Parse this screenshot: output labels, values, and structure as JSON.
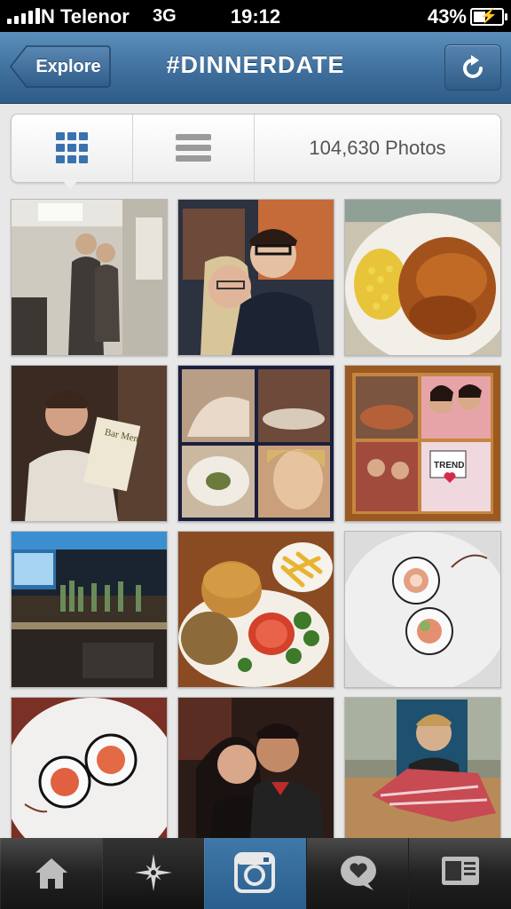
{
  "status_bar": {
    "carrier": "N Telenor",
    "network": "3G",
    "time": "19:12",
    "battery_text": "43%",
    "battery_level": 0.43,
    "signal_bars": 5
  },
  "nav": {
    "back_label": "Explore",
    "title": "#DINNERDATE",
    "refresh_icon": "refresh-icon"
  },
  "view_toggle": {
    "grid_icon": "grid-view-icon",
    "list_icon": "list-view-icon",
    "selected": "grid",
    "photo_count": "104,630 Photos"
  },
  "photos": [
    {
      "desc": "two young men standing in a room"
    },
    {
      "desc": "couple selfie"
    },
    {
      "desc": "chicken with corn on a plate"
    },
    {
      "desc": "man holding a menu"
    },
    {
      "desc": "collage of four dinner photos"
    },
    {
      "desc": "framed collage with couple"
    },
    {
      "desc": "bar with bottles"
    },
    {
      "desc": "burger, fries and salad"
    },
    {
      "desc": "sushi rolls on white plate"
    },
    {
      "desc": "sushi rolls close-up"
    },
    {
      "desc": "couple in restaurant"
    },
    {
      "desc": "cutout photo on table with napkin"
    }
  ],
  "tab_bar": {
    "tabs": [
      {
        "name": "home",
        "icon": "home-icon"
      },
      {
        "name": "explore",
        "icon": "explore-star-icon"
      },
      {
        "name": "camera",
        "icon": "camera-icon"
      },
      {
        "name": "news",
        "icon": "heart-bubble-icon"
      },
      {
        "name": "profile",
        "icon": "profile-card-icon"
      }
    ],
    "active": "camera"
  },
  "colors": {
    "nav_blue": "#3f6f9d",
    "active_tab": "#2a5f8d",
    "grid_icon_blue": "#3a72b0"
  }
}
